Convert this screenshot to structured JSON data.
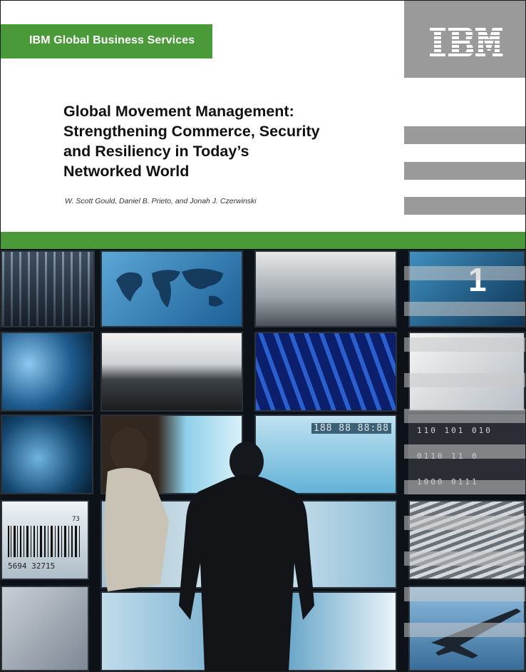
{
  "cover": {
    "division": "IBM Global Business Services",
    "brand": "IBM",
    "title_lines": [
      "Global Movement Management:",
      "Strengthening Commerce, Security",
      "and Resiliency in Today’s",
      "Networked World"
    ],
    "authors": "W. Scott Gould, Daniel B. Prieto, and Jonah J. Czerwinski"
  },
  "photo": {
    "screen_number": "1",
    "barcode_text": "5694 32715",
    "barcode_small": "73",
    "clock_text": "188 88 88:88",
    "binary_rows": [
      "110 101 010",
      "0110 11 0",
      "1000 0111"
    ]
  },
  "colors": {
    "accent_green": "#4a9a3a",
    "band_gray": "#9a9a9a",
    "title_text": "#111111"
  },
  "icons": [
    "ibm-logo-icon",
    "airplane-icon",
    "world-map-icon"
  ]
}
